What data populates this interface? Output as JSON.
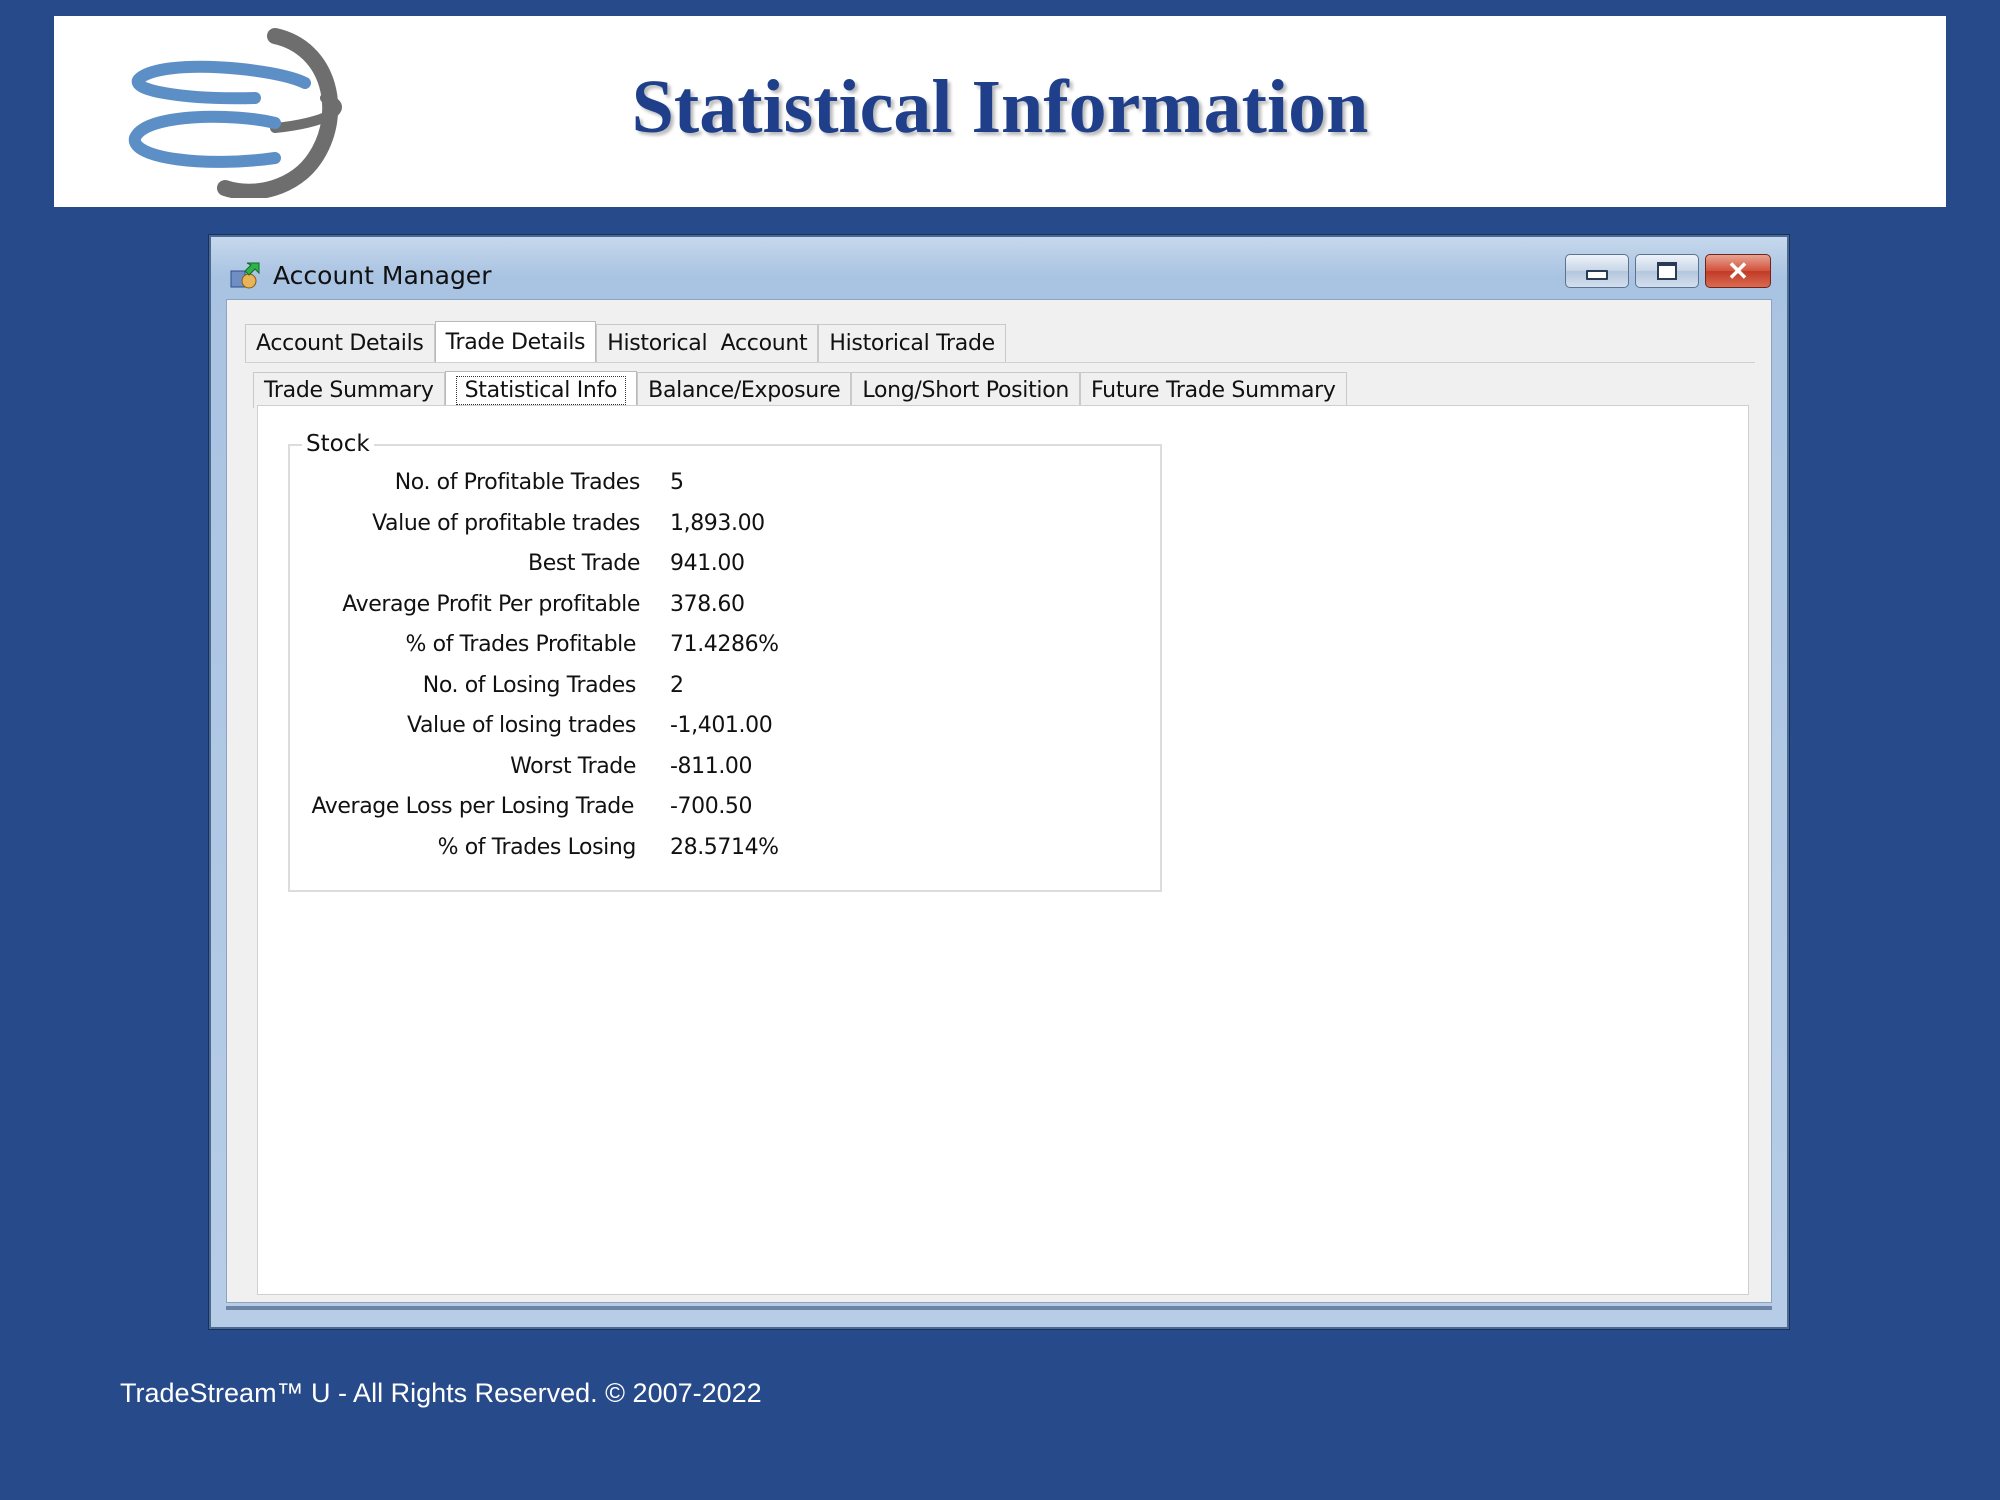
{
  "slide": {
    "title": "Statistical Information",
    "footer": "TradeStream™ U - All Rights Reserved. © 2007-2022"
  },
  "window": {
    "title": "Account Manager",
    "buttons": {
      "minimize_icon": "minimize-icon",
      "maximize_icon": "maximize-icon",
      "close_glyph": "✕"
    }
  },
  "tabs": [
    {
      "label": "Account Details",
      "active": false
    },
    {
      "label": "Trade Details",
      "active": true
    },
    {
      "label": "Historical  Account",
      "active": false
    },
    {
      "label": "Historical Trade",
      "active": false
    }
  ],
  "subtabs": [
    {
      "label": "Trade Summary",
      "active": false
    },
    {
      "label": "Statistical Info",
      "active": true
    },
    {
      "label": "Balance/Exposure",
      "active": false
    },
    {
      "label": "Long/Short Position",
      "active": false
    },
    {
      "label": "Future Trade Summary",
      "active": false
    }
  ],
  "group": {
    "legend": "Stock",
    "stats": [
      {
        "label": "No. of Profitable Trades",
        "value": "5"
      },
      {
        "label": "Value of profitable trades",
        "value": "1,893.00"
      },
      {
        "label": "Best Trade",
        "value": "941.00"
      },
      {
        "label": "Average Profit Per profitable",
        "value": "378.60"
      },
      {
        "label": "% of Trades Profitable",
        "value": "71.4286%"
      },
      {
        "label": "No. of Losing Trades",
        "value": "2"
      },
      {
        "label": "Value of losing trades",
        "value": "-1,401.00"
      },
      {
        "label": "Worst Trade",
        "value": "-811.00"
      },
      {
        "label": "Average Loss per Losing Trade",
        "value": "-700.50"
      },
      {
        "label": "% of Trades Losing",
        "value": "28.5714%"
      }
    ]
  }
}
